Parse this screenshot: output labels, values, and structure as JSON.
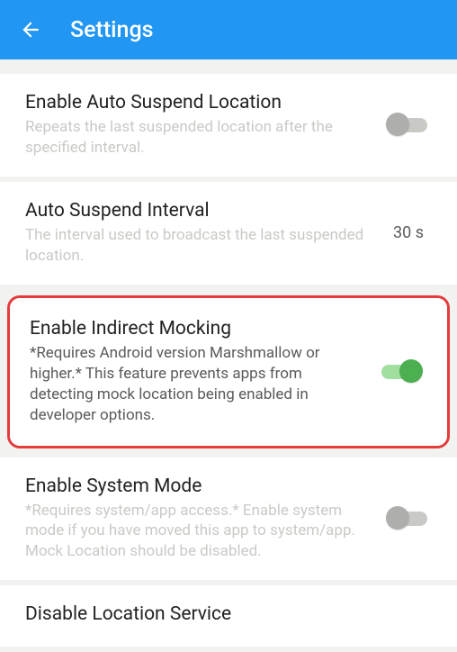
{
  "header": {
    "title": "Settings"
  },
  "settings": {
    "autoSuspend": {
      "title": "Enable Auto Suspend Location",
      "subtitle": "Repeats the last suspended location after the specified interval.",
      "enabled": false
    },
    "autoSuspendInterval": {
      "title": "Auto Suspend Interval",
      "subtitle": "The interval used to broadcast the last suspended location.",
      "value": "30 s"
    },
    "indirectMocking": {
      "title": "Enable Indirect Mocking",
      "subtitle": "*Requires Android version Marshmallow or higher.* This feature prevents apps from detecting mock location being enabled in developer options.",
      "enabled": true
    },
    "systemMode": {
      "title": "Enable System Mode",
      "subtitle": "*Requires system/app access.* Enable system mode if you have moved this app to system/app. Mock Location should be disabled.",
      "enabled": false
    },
    "disableLocation": {
      "title": "Disable Location Service"
    }
  }
}
